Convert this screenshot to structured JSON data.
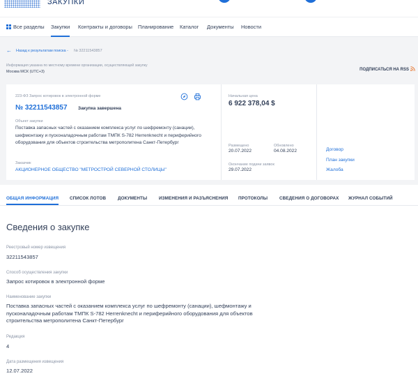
{
  "header": {
    "brand": "ЗАКУПКИ"
  },
  "nav": {
    "items": [
      "Все разделы",
      "Закупки",
      "Контракты и договоры",
      "Планирование",
      "Каталог",
      "Документы",
      "Новости"
    ]
  },
  "breadcrumb": {
    "back": "Назад к результатам поиска",
    "sep": "-",
    "number": "№ 32211543857"
  },
  "timezone": {
    "note": "Информация указана по местному времени организации, осуществляющей закупку",
    "value": "Москва МСК (UTC+3)"
  },
  "rss": {
    "label": "ПОДПИСАТЬСЯ НА RSS"
  },
  "card": {
    "law": "223-ФЗ Запрос котировок в электронной форме",
    "number": "№ 32211543857",
    "status": "Закупка завершена",
    "object_label": "Объект закупки",
    "object_value": "Поставка запасных частей с оказанием комплекса услуг по шефремонту (санации), шефмонтажу и пусконаладочным работам ТМПК S-782 Herrenknecht и периферийного оборудования для объектов строительства метрополитена Санкт-Петербург",
    "customer_label": "Заказчик",
    "customer_value": "АКЦИОНЕРНОЕ ОБЩЕСТВО \"МЕТРОСТРОЙ СЕВЕРНОЙ СТОЛИЦЫ\"",
    "price_label": "Начальная цена",
    "price_value": "6 922 378,04 $",
    "posted_label": "Размещено",
    "posted_value": "20.07.2022",
    "updated_label": "Обновлено",
    "updated_value": "04.08.2022",
    "deadline_label": "Окончание подачи заявок",
    "deadline_value": "29.07.2022",
    "links": [
      "Договор",
      "План закупки",
      "Жалоба"
    ]
  },
  "tabs": [
    "ОБЩАЯ ИНФОРМАЦИЯ",
    "СПИСОК ЛОТОВ",
    "ДОКУМЕНТЫ",
    "ИЗМЕНЕНИЯ И РАЗЪЯСНЕНИЯ",
    "ПРОТОКОЛЫ",
    "СВЕДЕНИЯ О ДОГОВОРАХ",
    "ЖУРНАЛ СОБЫТИЙ"
  ],
  "section": {
    "title": "Сведения о закупке",
    "fields": [
      {
        "label": "Реестровый номер извещения",
        "value": "32211543857"
      },
      {
        "label": "Способ осуществления закупки",
        "value": "Запрос котировок в электронной форме"
      },
      {
        "label": "Наименование закупки",
        "value": "Поставка запасных частей с оказанием комплекса услуг по шефремонту (санации), шефмонтажу и пусконаладочным работам ТМПК S-782 Herrenknecht и периферийного оборудования для объектов строительства метрополитена Санкт-Петербург"
      },
      {
        "label": "Редакция",
        "value": "4"
      },
      {
        "label": "Дата размещения извещения",
        "value": "12.07.2022"
      }
    ]
  },
  "colors": {
    "accent": "#1f6fd8",
    "text": "#334059",
    "muted": "#8a94a6",
    "rss": "#e8732a"
  }
}
